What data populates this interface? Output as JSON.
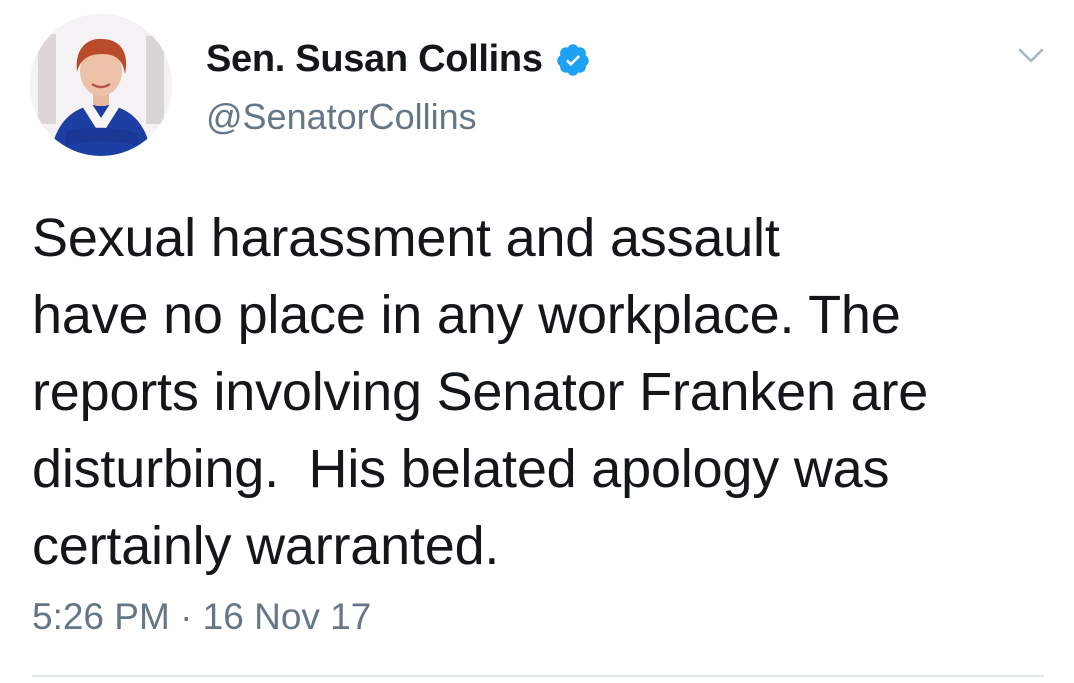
{
  "author": {
    "display_name": "Sen. Susan Collins",
    "handle": "@SenatorCollins",
    "verified": true,
    "avatar_icon": "profile-photo-icon"
  },
  "tweet": {
    "text": "Sexual harassment and assault\nhave no place in any workplace. The\nreports involving Senator Franken are\ndisturbing.  His belated apology was\ncertainly warranted.",
    "timestamp": "5:26 PM · 16 Nov 17"
  },
  "icons": {
    "verified": "verified-badge-icon",
    "menu": "chevron-down-icon"
  },
  "colors": {
    "verified_blue": "#1da1f2",
    "text_primary": "#14171a",
    "text_secondary": "#657786",
    "divider": "#e1e8ed"
  }
}
